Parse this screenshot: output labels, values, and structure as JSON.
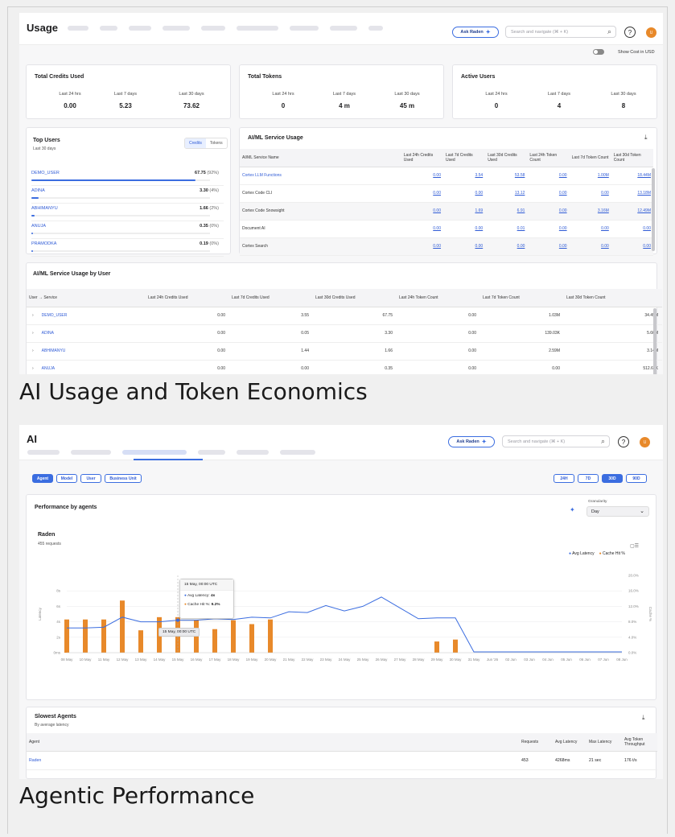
{
  "usage": {
    "title": "Usage",
    "ask_label": "Ask Raden",
    "search_placeholder": "Search and navigate (⌘ + K)",
    "help": "?",
    "avatar": "U",
    "show_cost_label": "Show Cost in USD",
    "kpis": [
      {
        "title": "Total Credits Used",
        "labels": [
          "Last 24 hrs",
          "Last 7 days",
          "Last 30 days"
        ],
        "values": [
          "0.00",
          "5.23",
          "73.62"
        ]
      },
      {
        "title": "Total Tokens",
        "labels": [
          "Last 24 hrs",
          "Last 7 days",
          "Last 30 days"
        ],
        "values": [
          "0",
          "4 m",
          "45 m"
        ]
      },
      {
        "title": "Active Users",
        "labels": [
          "Last 24 hrs",
          "Last 7 days",
          "Last 30 days"
        ],
        "values": [
          "0",
          "4",
          "8"
        ]
      }
    ],
    "top_users": {
      "title": "Top Users",
      "subtitle": "Last 30 days",
      "toggle": [
        "Credits",
        "Tokens"
      ],
      "rows": [
        {
          "name": "DEMO_USER",
          "value": "67.75",
          "pct": "(92%)",
          "share": 0.92
        },
        {
          "name": "ADINA",
          "value": "3.30",
          "pct": "(4%)",
          "share": 0.04
        },
        {
          "name": "ABHIMANYU",
          "value": "1.66",
          "pct": "(2%)",
          "share": 0.02
        },
        {
          "name": "ANUJA",
          "value": "0.35",
          "pct": "(0%)",
          "share": 0.0
        },
        {
          "name": "PRAMODKA",
          "value": "0.19",
          "pct": "(0%)",
          "share": 0.0
        }
      ]
    },
    "service_usage": {
      "title": "AI/ML Service Usage",
      "headers": [
        "AI/ML Service Name",
        "Last 24h Credits Used",
        "Last 7d Credits Used",
        "Last 30d Credits Used",
        "Last 24h Token Count",
        "Last 7d Token Count",
        "Last 30d Token Count"
      ],
      "rows": [
        [
          "Cortex LLM Functions",
          "0.00",
          "3.54",
          "53.58",
          "0.00",
          "1.00M",
          "18.44M"
        ],
        [
          "Cortex Code CLI",
          "0.00",
          "0.00",
          "13.12",
          "0.00",
          "0.00",
          "13.18M"
        ],
        [
          "Cortex Code Snowsight",
          "0.00",
          "1.69",
          "6.91",
          "0.00",
          "3.16M",
          "12.49M"
        ],
        [
          "Document AI",
          "0.00",
          "0.00",
          "0.01",
          "0.00",
          "0.00",
          "0.00"
        ],
        [
          "Cortex Search",
          "0.00",
          "0.00",
          "0.00",
          "0.00",
          "0.00",
          "0.00"
        ]
      ]
    },
    "by_user": {
      "title": "AI/ML Service Usage by User",
      "headers": [
        "User → Service",
        "Last 24h Credits Used",
        "Last 7d Credits Used",
        "Last 30d Credits Used",
        "Last 24h Token Count",
        "Last 7d Token Count",
        "Last 30d Token Count"
      ],
      "rows": [
        [
          "DEMO_USER",
          "0.00",
          "3.55",
          "67.75",
          "0.00",
          "1.03M",
          "34.49M"
        ],
        [
          "ADINA",
          "0.00",
          "0.05",
          "3.30",
          "0.00",
          "139.03K",
          "5.66M"
        ],
        [
          "ABHIMANYU",
          "0.00",
          "1.44",
          "1.66",
          "0.00",
          "2.59M",
          "3.14M"
        ],
        [
          "ANUJA",
          "0.00",
          "0.00",
          "0.35",
          "0.00",
          "0.00",
          "512.67K"
        ]
      ]
    },
    "caption": "AI Usage and Token Economics"
  },
  "agentic": {
    "title": "AI",
    "ask_label": "Ask Raden",
    "search_placeholder": "Search and navigate (⌘ + K)",
    "help": "?",
    "avatar": "U",
    "filters": [
      "Agent",
      "Model",
      "User",
      "Business Unit"
    ],
    "ranges": [
      "24H",
      "7D",
      "30D",
      "90D"
    ],
    "active_range": "30D",
    "perf_title": "Performance by agents",
    "granularity_label": "Granularity",
    "granularity_value": "Day",
    "tooltip": {
      "date": "15 May, 00:00 UTC",
      "latency_label": "Avg Latency:",
      "latency_value": "4s",
      "cache_label": "Cache Hit %:",
      "cache_value": "9.2%",
      "axis_label": "15 May, 00:00 UTC"
    },
    "slowest": {
      "title": "Slowest Agents",
      "subtitle": "By average latency",
      "headers": [
        "Agent",
        "Requests",
        "Avg Latency",
        "Max Latency",
        "Avg Token Throughput"
      ],
      "rows": [
        [
          "Raden",
          "453",
          "4268ms",
          "21 sec",
          "176 t/s"
        ]
      ]
    },
    "caption": "Agentic Performance"
  },
  "chart_data": {
    "type": "bar",
    "title": "Raden",
    "subtitle": "455 requests",
    "xlabel": "",
    "ylabel": "Latency",
    "ylabel_right": "Cache %",
    "ylim": [
      0,
      10
    ],
    "ylim_right": [
      0,
      20
    ],
    "yticks": [
      "0ms",
      "2s",
      "4s",
      "6s",
      "8s"
    ],
    "yticks_right": [
      "0.0%",
      "4.0%",
      "8.0%",
      "12.0%",
      "16.0%",
      "20.0%"
    ],
    "categories": [
      "08 May",
      "10 May",
      "11 May",
      "12 May",
      "13 May",
      "14 May",
      "15 May",
      "16 May",
      "17 May",
      "18 May",
      "19 May",
      "20 May",
      "21 May",
      "22 May",
      "23 May",
      "24 May",
      "25 May",
      "26 May",
      "27 May",
      "28 May",
      "29 May",
      "30 May",
      "31 May",
      "Jun '26",
      "02 Jun",
      "03 Jun",
      "04 Jun",
      "05 Jun",
      "06 Jun",
      "07 Jun",
      "08 Jun"
    ],
    "legend": [
      "Avg Latency",
      "Cache Hit %"
    ],
    "legend_position": "top-right",
    "series": [
      {
        "name": "Cache Hit %",
        "type": "bar",
        "color": "#e8892a",
        "values": [
          8.6,
          8.6,
          8.6,
          13.5,
          5.8,
          9.2,
          9.2,
          8.4,
          6.1,
          8.4,
          7.4,
          8.6,
          0,
          0,
          0,
          0,
          0,
          0,
          0,
          0,
          2.9,
          3.4,
          0,
          0,
          0,
          0,
          0,
          0,
          0,
          0,
          0
        ]
      },
      {
        "name": "Avg Latency",
        "type": "line",
        "color": "#3b6de0",
        "values": [
          3.2,
          3.2,
          3.3,
          4.6,
          4.0,
          4.0,
          4.2,
          4.2,
          4.4,
          4.3,
          4.6,
          4.5,
          5.3,
          5.2,
          6.1,
          5.4,
          6.0,
          7.2,
          5.8,
          4.4,
          4.5,
          4.5,
          0.1,
          0.1,
          0.1,
          0.1,
          0.1,
          0.1,
          0.1,
          0.1,
          0.1
        ]
      }
    ]
  }
}
